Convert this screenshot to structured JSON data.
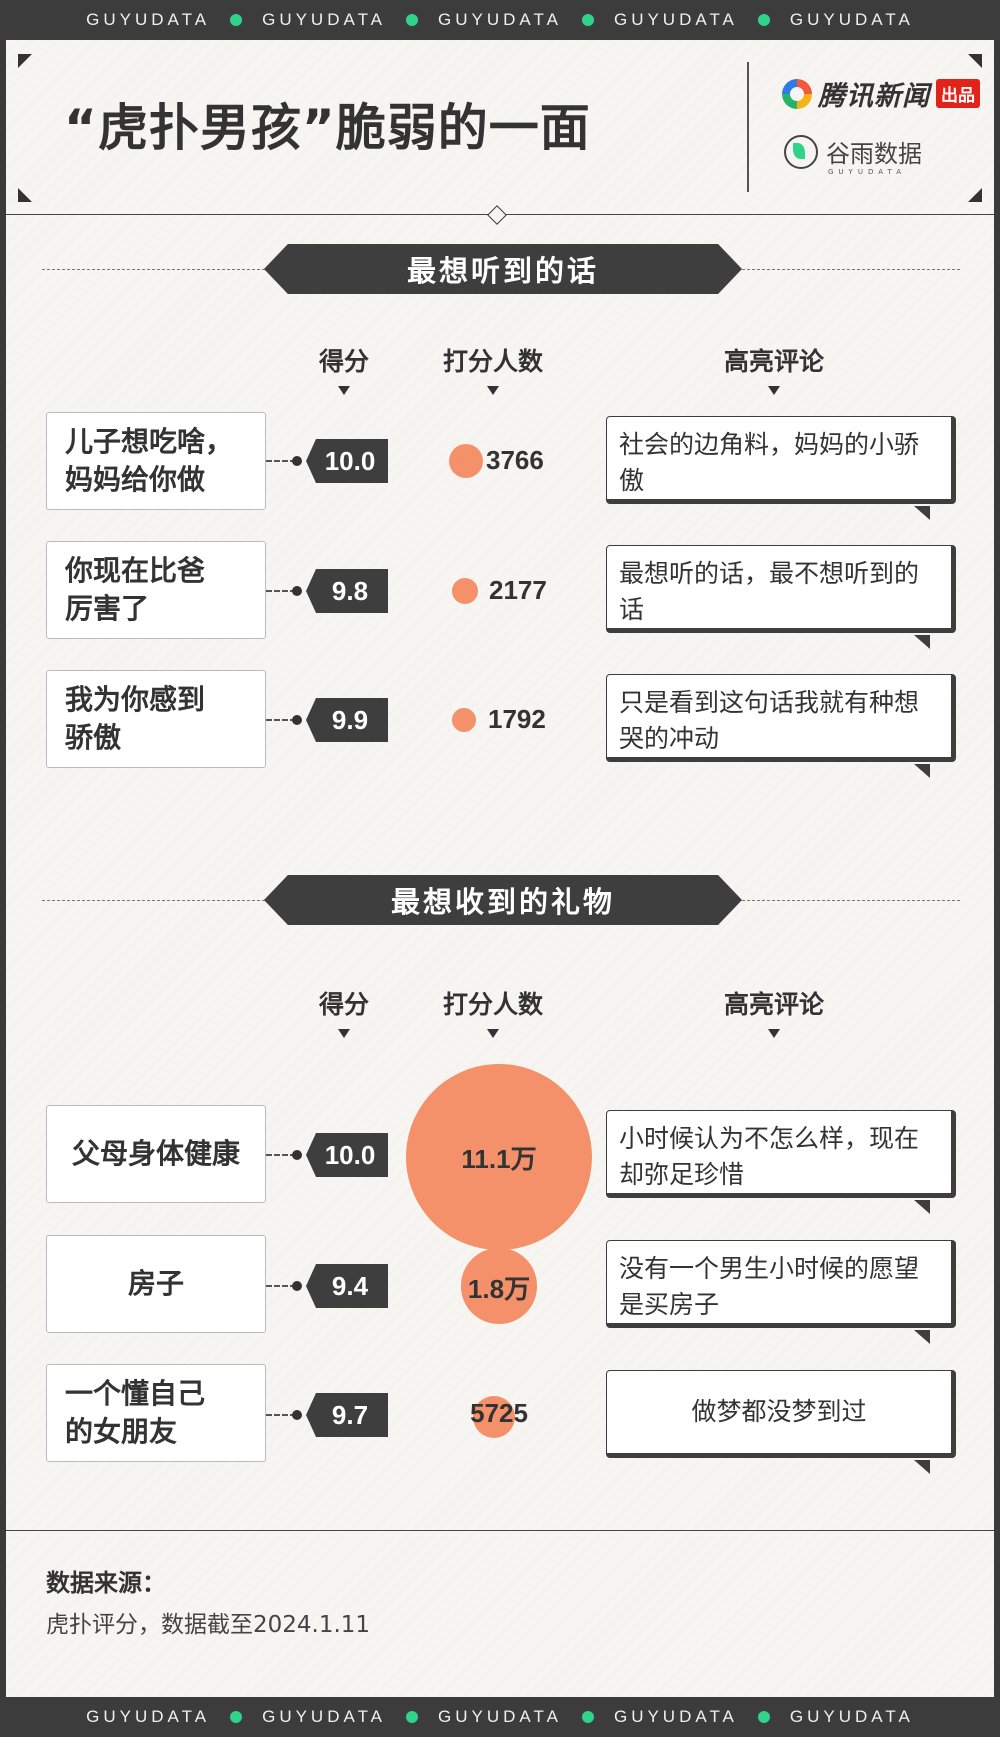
{
  "brand": {
    "text": "GUYUDATA"
  },
  "header": {
    "title": "“虎扑男孩”脆弱的一面",
    "tencent_name": "腾讯新闻",
    "tencent_badge": "出品",
    "guyu_name": "谷雨数据",
    "guyu_sub": "GUYUDATA"
  },
  "columns": {
    "score": "得分",
    "raters": "打分人数",
    "comment": "高亮评论"
  },
  "sections": [
    {
      "title": "最想听到的话",
      "rows": [
        {
          "phrase_lines": [
            "儿子想吃啥，",
            "妈妈给你做"
          ],
          "score": "10.0",
          "raters": "3766",
          "raters_value": 3766,
          "comment": "社会的边角料，妈妈的小骄傲"
        },
        {
          "phrase_lines": [
            "你现在比爸",
            "厉害了"
          ],
          "score": "9.8",
          "raters": "2177",
          "raters_value": 2177,
          "comment": "最想听的话，最不想听到的话"
        },
        {
          "phrase_lines": [
            "我为你感到",
            "骄傲"
          ],
          "score": "9.9",
          "raters": "1792",
          "raters_value": 1792,
          "comment": "只是看到这句话我就有种想哭的冲动"
        }
      ]
    },
    {
      "title": "最想收到的礼物",
      "rows": [
        {
          "phrase_lines": [
            "父母身体健康"
          ],
          "score": "10.0",
          "raters": "11.1万",
          "raters_value": 111000,
          "comment": "小时候认为不怎么样，现在却弥足珍惜"
        },
        {
          "phrase_lines": [
            "房子"
          ],
          "score": "9.4",
          "raters": "1.8万",
          "raters_value": 18000,
          "comment": "没有一个男生小时候的愿望是买房子"
        },
        {
          "phrase_lines": [
            "一个懂自己",
            "的女朋友"
          ],
          "score": "9.7",
          "raters": "5725",
          "raters_value": 5725,
          "comment": "做梦都没梦到过"
        }
      ]
    }
  ],
  "source": {
    "label": "数据来源：",
    "text": "虎扑评分，数据截至2024.1.11"
  },
  "colors": {
    "bubble": "#f4916b",
    "dark": "#3e3e3e",
    "brand_dot": "#2fd38a"
  }
}
